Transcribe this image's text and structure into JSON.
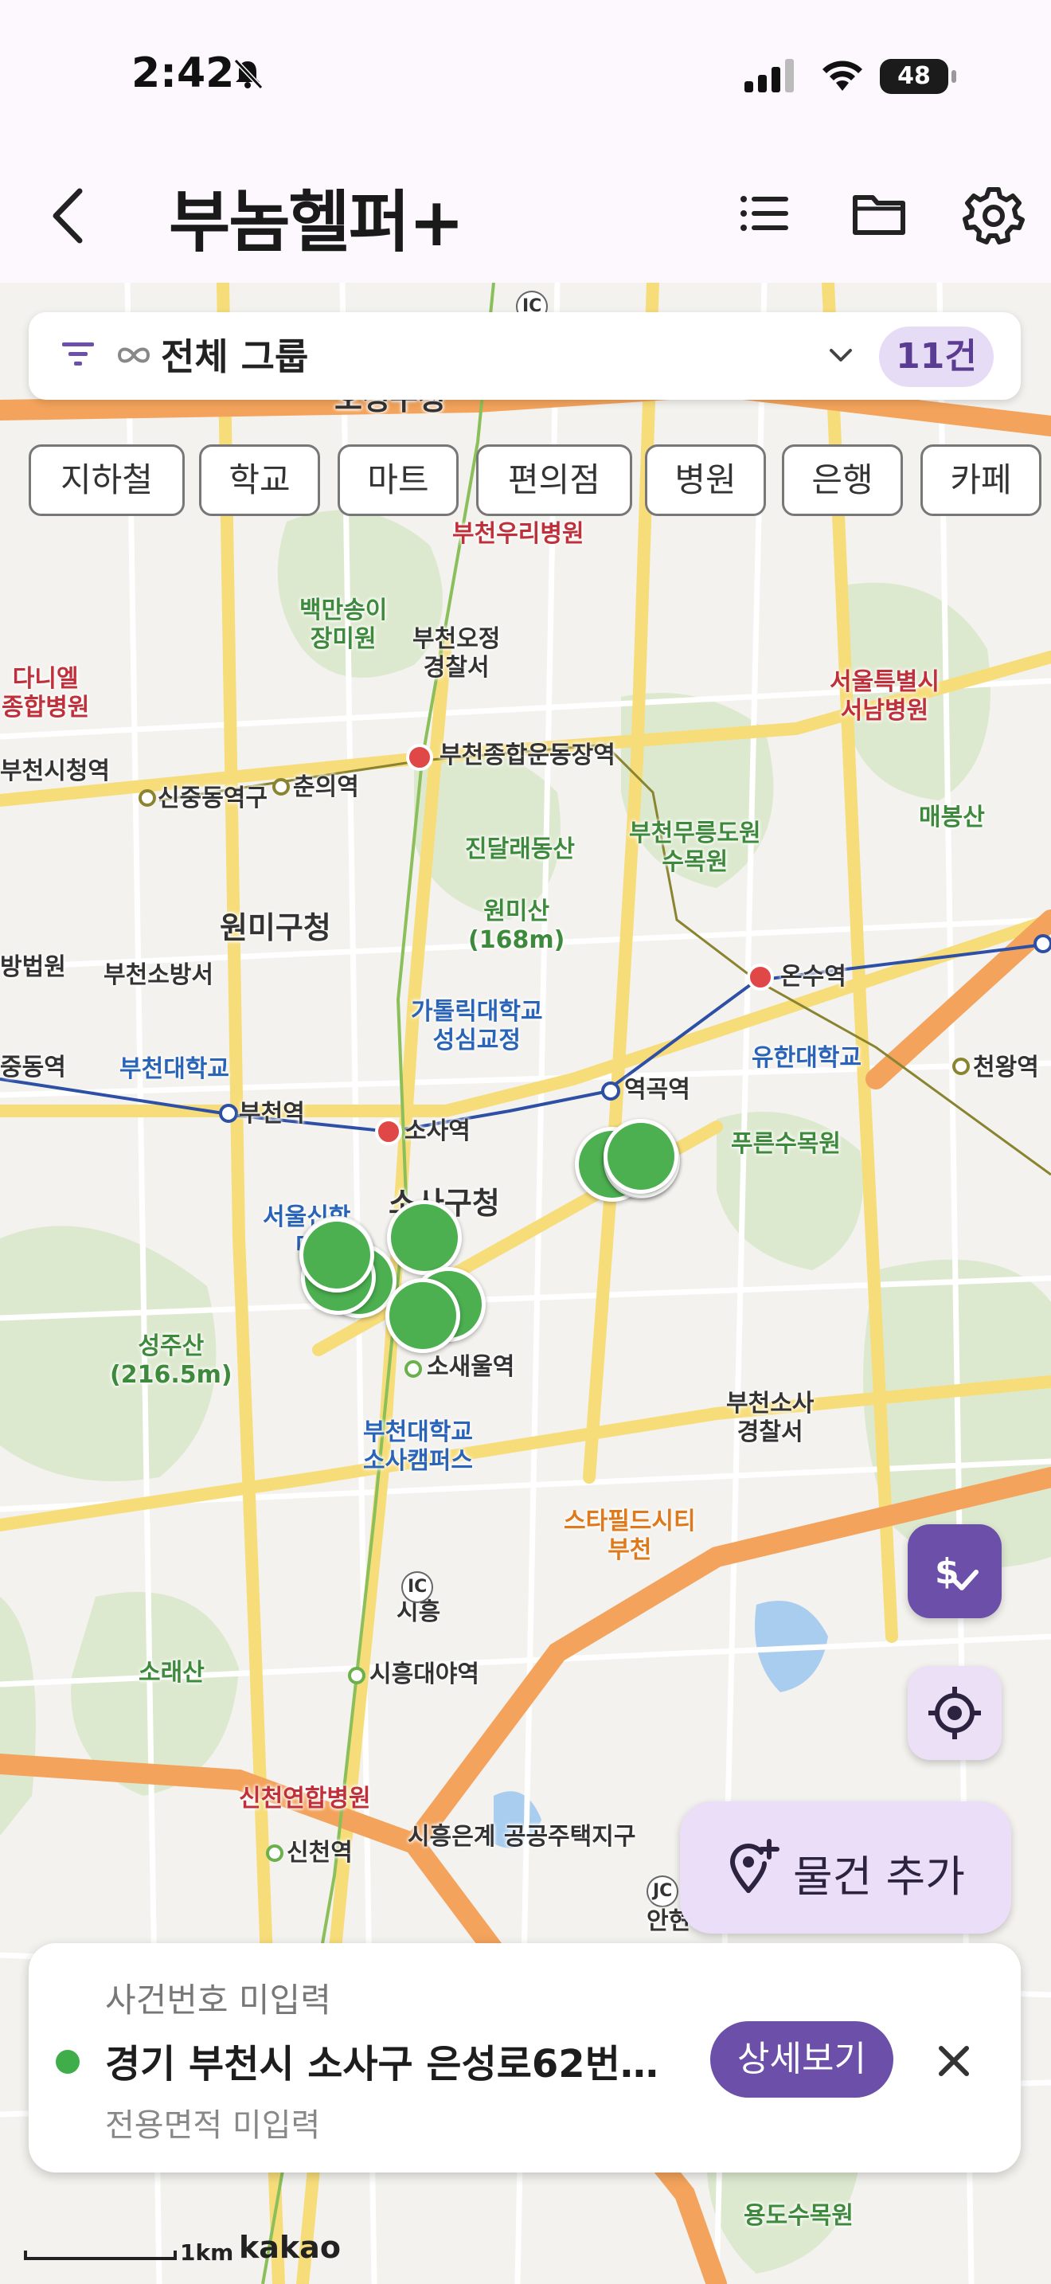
{
  "status_bar": {
    "time": "2:42",
    "battery": "48"
  },
  "header": {
    "title": "부놈헬퍼+"
  },
  "filter": {
    "group_label": "전체 그룹",
    "count": "11건"
  },
  "chips": [
    "지하철",
    "학교",
    "마트",
    "편의점",
    "병원",
    "은행",
    "카페"
  ],
  "map_labels": {
    "ojeong_gu": "오정구청",
    "bucheon_woori_hospital": "부천우리병원",
    "baekmansong": "백만송이\n장미원",
    "ojeong_police": "부천오정\n경찰서",
    "dainel_hospital": "다니엘\n종합병원",
    "seoul_seonam_hospital": "서울특별시\n서남병원",
    "bucheon_city_hall_stn": "부천시청역",
    "sinjungdong_stn": "신중동역구",
    "chunui_stn": "춘의역",
    "sports_complex_stn": "부천종합운동장역",
    "jindallae": "진달래동산",
    "mureung_arboretum": "부천무릉도원\n수목원",
    "maebongsan": "매봉산",
    "wonmi_gu": "원미구청",
    "wonmisan": "원미산\n(168m)",
    "fire_station": "부천소방서",
    "court": "방법원",
    "onsu_stn": "온수역",
    "catholic_univ": "가톨릭대학교\n성심교정",
    "bucheon_univ": "부천대학교",
    "yuhan_univ": "유한대학교",
    "cheonwang_stn": "천왕역",
    "jungdong_stn": "중동역",
    "bucheon_stn": "부천역",
    "sosa_stn": "소사역",
    "yeokgok_stn": "역곡역",
    "pureun_arboretum": "푸른수목원",
    "sosa_gu": "소사구청",
    "seoul_theology": "서울신학\n대",
    "seongjusan": "성주산\n(216.5m)",
    "sosaeul_stn": "소새울역",
    "sosa_police": "부천소사\n경찰서",
    "bucheon_univ_sosa": "부천대학교\n소사캠퍼스",
    "starfield": "스타필드시티\n부천",
    "siheung": "시흥",
    "soraesan": "소래산",
    "siheungdaeya_stn": "시흥대야역",
    "sincheon_hospital": "신천연합병원",
    "sincheon_stn": "신천역",
    "housing_district": "시흥은계 공공주택지구",
    "yongdo_arboretum": "용도수목원",
    "ic": "IC",
    "ic2": "IC",
    "jc": "JC",
    "anhyeon": "안현"
  },
  "fab": {
    "add_label": "물건 추가"
  },
  "card": {
    "case_number": "사건번호 미입력",
    "address": "경기 부천시 소사구 은성로62번…",
    "area": "전용면적 미입력",
    "detail_label": "상세보기"
  },
  "map_footer": {
    "scale": "1km",
    "brand": "kakao"
  },
  "colors": {
    "accent": "#6b4fa8",
    "marker": "#4caf50",
    "badge_bg": "#e7dcf6"
  }
}
